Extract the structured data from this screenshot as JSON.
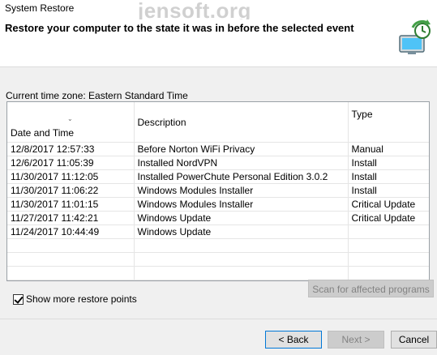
{
  "window": {
    "title": "System Restore"
  },
  "watermark": "jensoft.org",
  "header": {
    "heading": "Restore your computer to the state it was in before the selected event"
  },
  "timezone_label": "Current time zone: Eastern Standard Time",
  "table": {
    "columns": [
      "Date and Time",
      "Description",
      "Type"
    ],
    "rows": [
      {
        "date": "12/8/2017 12:57:33",
        "description": "Before Norton WiFi Privacy",
        "type": "Manual"
      },
      {
        "date": "12/6/2017 11:05:39",
        "description": "Installed NordVPN",
        "type": "Install"
      },
      {
        "date": "11/30/2017 11:12:05",
        "description": "Installed PowerChute Personal Edition 3.0.2",
        "type": "Install"
      },
      {
        "date": "11/30/2017 11:06:22",
        "description": "Windows Modules Installer",
        "type": "Install"
      },
      {
        "date": "11/30/2017 11:01:15",
        "description": "Windows Modules Installer",
        "type": "Critical Update"
      },
      {
        "date": "11/27/2017 11:42:21",
        "description": "Windows Update",
        "type": "Critical Update"
      },
      {
        "date": "11/24/2017 10:44:49",
        "description": "Windows Update",
        "type": ""
      }
    ]
  },
  "scan_button": "Scan for affected programs",
  "show_more": {
    "label": "Show more restore points",
    "checked": true
  },
  "buttons": {
    "back": "< Back",
    "next": "Next >",
    "cancel": "Cancel"
  }
}
